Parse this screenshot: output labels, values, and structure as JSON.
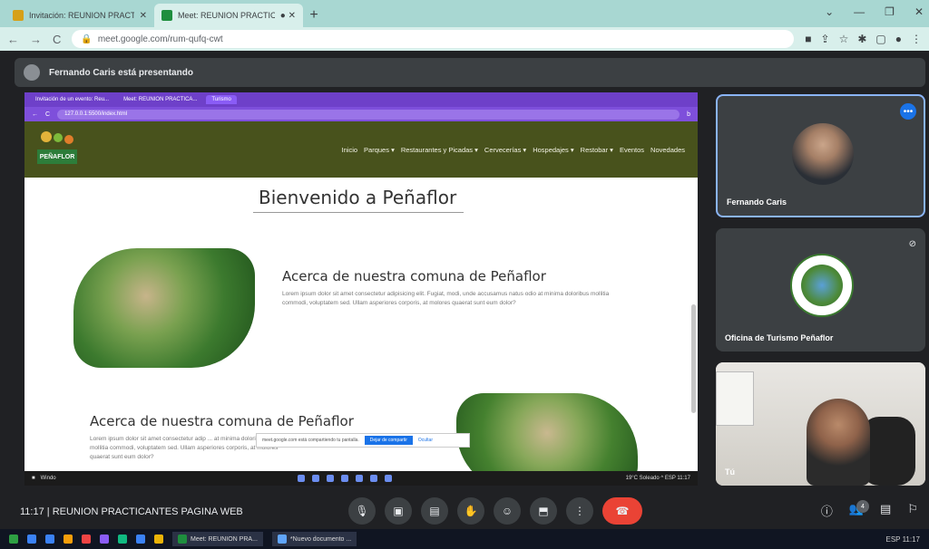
{
  "browser": {
    "tabs": [
      {
        "title": "Invitación: REUNION PRACTICANTES",
        "fav_color": "#d6a018",
        "active": false
      },
      {
        "title": "Meet: REUNION PRACTICANTES",
        "fav_color": "#1e8e3e",
        "active": true
      }
    ],
    "url": "meet.google.com/rum-qufq-cwt",
    "window_controls": [
      "⌄",
      "—",
      "❐",
      "✕"
    ]
  },
  "meet": {
    "presenter_text": "Fernando Caris está presentando",
    "meeting_time": "11:17",
    "meeting_title": "REUNION PRACTICANTES PAGINA WEB",
    "participants": [
      {
        "name": "Fernando Caris"
      },
      {
        "name": "Oficina de Turismo Peñaflor"
      },
      {
        "name": "Tú"
      }
    ],
    "controls": {
      "mic": "🎙",
      "camera": "▣",
      "captions": "▤",
      "hand": "✋",
      "emoji": "☺",
      "present": "⬒",
      "more": "⋮",
      "end": "☎"
    },
    "right_controls": {
      "info": "ⓘ",
      "people": "👥",
      "chat": "▤",
      "activities": "⚐"
    },
    "people_count": "4"
  },
  "shared_screen": {
    "tabs": [
      "Invitación de un evento: Reu...",
      "Meet: REUNION PRACTICA...",
      "Turismo"
    ],
    "url": "127.0.0.1:5500/index.html",
    "logo_text": "PEÑAFLOR",
    "menu": [
      "Inicio",
      "Parques ▾",
      "Restaurantes y Picadas ▾",
      "Cervecerías ▾",
      "Hospedajes ▾",
      "Restobar ▾",
      "Eventos",
      "Novedades"
    ],
    "welcome": "Bienvenido a Peñaflor",
    "section1_title": "Acerca de nuestra comuna de Peñaflor",
    "section1_text": "Lorem ipsum dolor sit amet consectetur adipisicing elit. Fugiat, modi, unde accusamus natus odio at minima doloribus mollitia commodi, voluptatem sed. Ullam asperiores corporis, at molores quaerat sunt eum dolor?",
    "section2_title": "Acerca de nuestra comuna de Peñaflor",
    "section2_text": "Lorem ipsum dolor sit amet consectetur adip ... at minima doloribus mollitia commodi, voluptatem sed. Ullam asperiores corporis, at molores quaerat sunt eum dolor?",
    "share_bar_text": "meet.google.com está compartiendo tu pantalla.",
    "share_stop": "Dejar de compartir",
    "share_hide": "Ocultar",
    "taskbar_left": "Windo",
    "taskbar_tray": "19°C Soleado  ^  ESP  11:17"
  },
  "taskbar": {
    "apps": [
      {
        "label": "Meet: REUNION PRA..."
      },
      {
        "label": "*Nuevo documento ..."
      }
    ],
    "tray": "ESP  11:17"
  }
}
